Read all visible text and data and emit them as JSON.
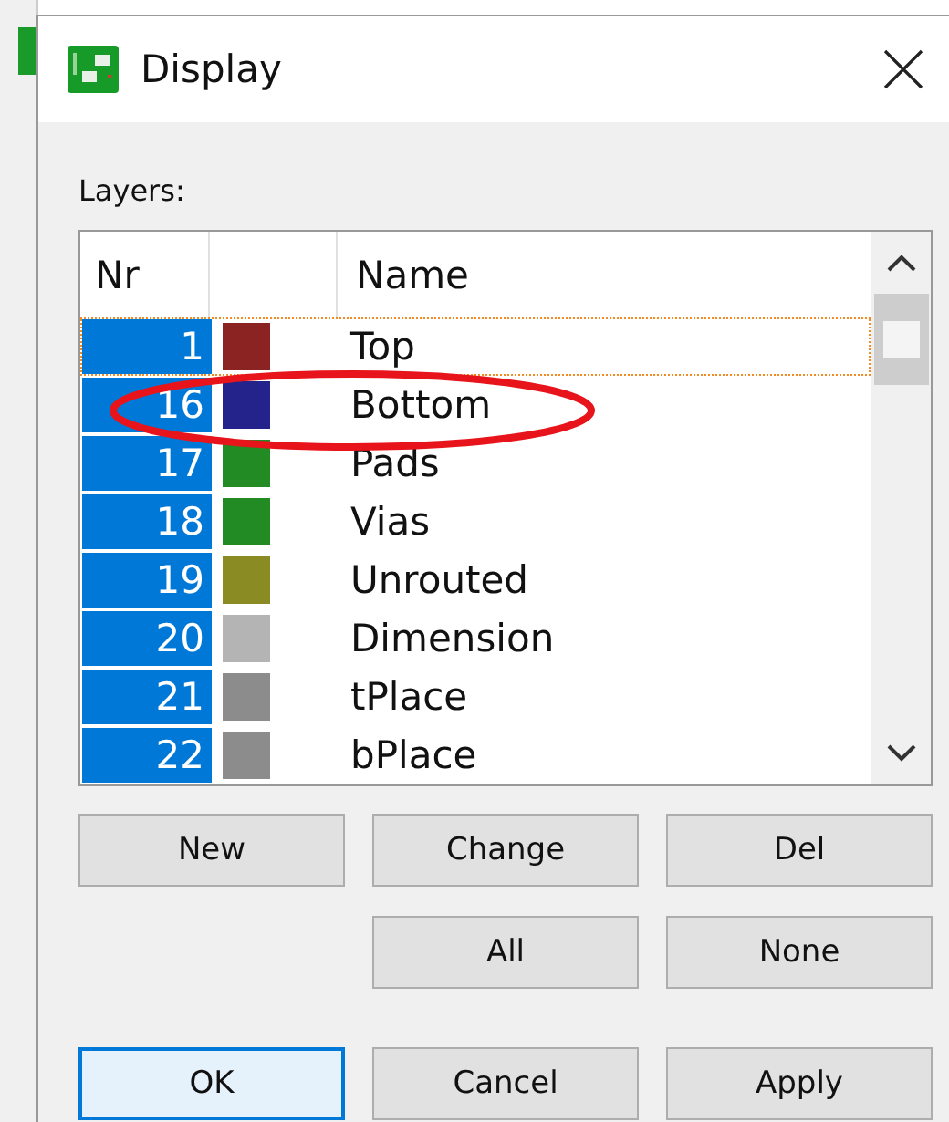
{
  "window": {
    "title": "Display"
  },
  "layers": {
    "label": "Layers:",
    "columns": [
      "Nr",
      "",
      "Name"
    ],
    "rows": [
      {
        "nr": "1",
        "name": "Top",
        "color": "#8b2323",
        "visible": true,
        "focused": true,
        "circled": false
      },
      {
        "nr": "16",
        "name": "Bottom",
        "color": "#23238b",
        "visible": true,
        "focused": false,
        "circled": true
      },
      {
        "nr": "17",
        "name": "Pads",
        "color": "#238b23",
        "visible": true,
        "focused": false,
        "circled": false
      },
      {
        "nr": "18",
        "name": "Vias",
        "color": "#238b23",
        "visible": true,
        "focused": false,
        "circled": false
      },
      {
        "nr": "19",
        "name": "Unrouted",
        "color": "#8b8b23",
        "visible": true,
        "focused": false,
        "circled": false
      },
      {
        "nr": "20",
        "name": "Dimension",
        "color": "#b4b4b4",
        "visible": true,
        "focused": false,
        "circled": false
      },
      {
        "nr": "21",
        "name": "tPlace",
        "color": "#8c8c8c",
        "visible": true,
        "focused": false,
        "circled": false
      },
      {
        "nr": "22",
        "name": "bPlace",
        "color": "#8c8c8c",
        "visible": true,
        "focused": false,
        "circled": false
      }
    ]
  },
  "buttons": [
    {
      "label": "New",
      "default": false
    },
    {
      "label": "Change",
      "default": false
    },
    {
      "label": "Del",
      "default": false
    },
    {
      "kind": "spacer"
    },
    {
      "label": "All",
      "default": false
    },
    {
      "label": "None",
      "default": false
    },
    {
      "label": "OK",
      "default": true
    },
    {
      "label": "Cancel",
      "default": false
    },
    {
      "label": "Apply",
      "default": false
    }
  ]
}
